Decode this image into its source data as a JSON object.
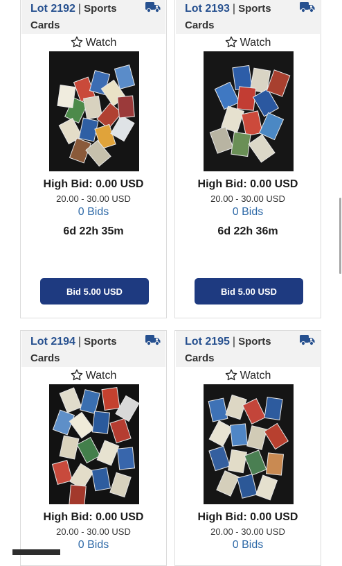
{
  "lots": [
    {
      "lot": "Lot 2192",
      "category_a": "Sports",
      "category_b": "Cards",
      "watch": "Watch",
      "high_bid": "High Bid: 0.00 USD",
      "range": "20.00 - 30.00 USD",
      "bids": "0 Bids",
      "time_left": "6d 22h 35m",
      "bid_button": "Bid 5.00 USD"
    },
    {
      "lot": "Lot 2193",
      "category_a": "Sports",
      "category_b": "Cards",
      "watch": "Watch",
      "high_bid": "High Bid: 0.00 USD",
      "range": "20.00 - 30.00 USD",
      "bids": "0 Bids",
      "time_left": "6d 22h 36m",
      "bid_button": "Bid 5.00 USD"
    },
    {
      "lot": "Lot 2194",
      "category_a": "Sports",
      "category_b": "Cards",
      "watch": "Watch",
      "high_bid": "High Bid: 0.00 USD",
      "range": "20.00 - 30.00 USD",
      "bids": "0 Bids"
    },
    {
      "lot": "Lot 2195",
      "category_a": "Sports",
      "category_b": "Cards",
      "watch": "Watch",
      "high_bid": "High Bid: 0.00 USD",
      "range": "20.00 - 30.00 USD",
      "bids": "0 Bids"
    }
  ],
  "colors": {
    "lot_number": "#26508f",
    "bids_link": "#2f6aa8",
    "bid_button": "#1e3a80",
    "header_bg": "#f2f2f2"
  },
  "icons": {
    "shipping": "truck-icon",
    "watch": "star-outline-icon"
  }
}
